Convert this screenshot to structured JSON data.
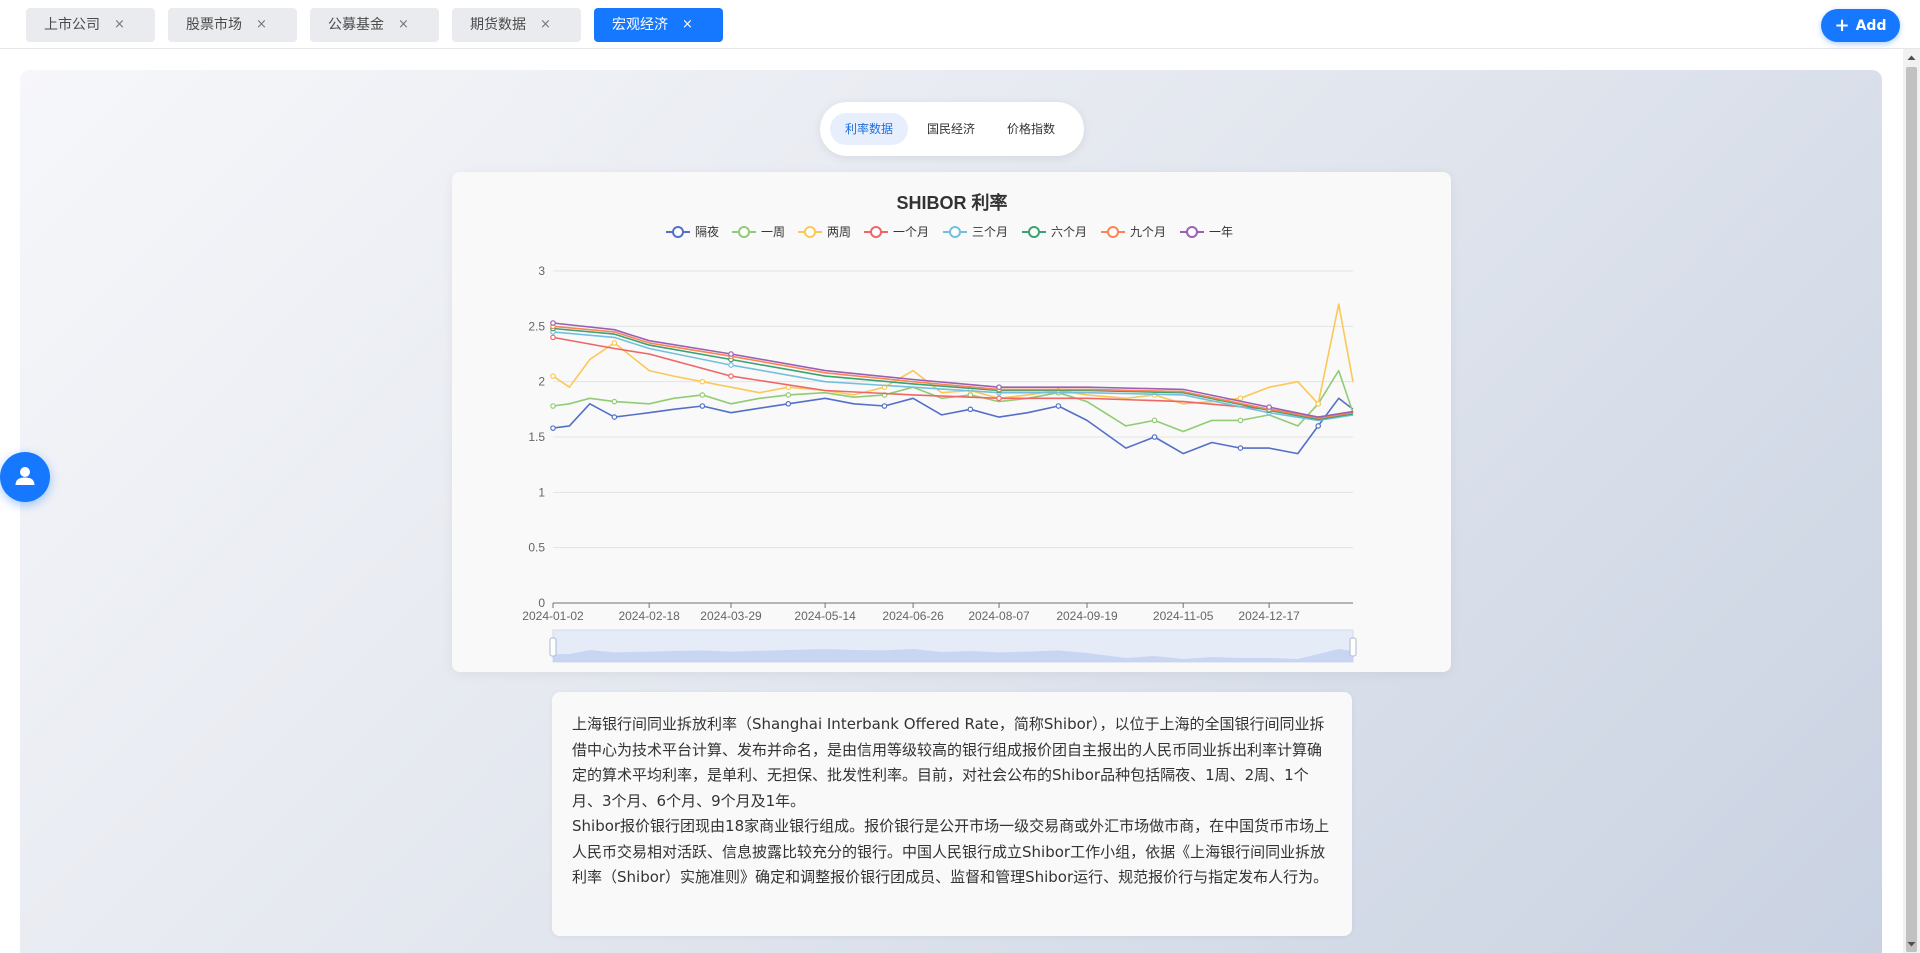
{
  "tabs": [
    {
      "label": "上市公司",
      "close": "×",
      "active": false
    },
    {
      "label": "股票市场",
      "close": "×",
      "active": false
    },
    {
      "label": "公募基金",
      "close": "×",
      "active": false
    },
    {
      "label": "期货数据",
      "close": "×",
      "active": false
    },
    {
      "label": "宏观经济",
      "close": "×",
      "active": true
    }
  ],
  "add_button": {
    "label": "Add",
    "icon": "plus-icon"
  },
  "subtabs": [
    {
      "label": "利率数据",
      "active": true
    },
    {
      "label": "国民经济",
      "active": false
    },
    {
      "label": "价格指数",
      "active": false
    }
  ],
  "colors": {
    "accent": "#1677ff"
  },
  "chart_data": {
    "type": "line",
    "title": "SHIBOR 利率",
    "ylim": [
      0,
      3
    ],
    "y_ticks": [
      "0",
      "0.5",
      "1",
      "1.5",
      "2",
      "2.5",
      "3"
    ],
    "x_tick_labels": [
      "2024-01-02",
      "2024-02-18",
      "2024-03-29",
      "2024-05-14",
      "2024-06-26",
      "2024-08-07",
      "2024-09-19",
      "2024-11-05",
      "2024-12-17"
    ],
    "x_range": [
      "2024-01-02",
      "2025-01-27"
    ],
    "legend_position": "top-center",
    "grid": true,
    "series": [
      {
        "name": "隔夜",
        "color": "#5470c6",
        "x": [
          "2024-01-02",
          "2024-01-10",
          "2024-01-20",
          "2024-02-01",
          "2024-02-18",
          "2024-03-01",
          "2024-03-15",
          "2024-03-29",
          "2024-04-12",
          "2024-04-26",
          "2024-05-14",
          "2024-05-28",
          "2024-06-12",
          "2024-06-26",
          "2024-07-10",
          "2024-07-24",
          "2024-08-07",
          "2024-08-21",
          "2024-09-05",
          "2024-09-19",
          "2024-10-08",
          "2024-10-22",
          "2024-11-05",
          "2024-11-19",
          "2024-12-03",
          "2024-12-17",
          "2024-12-31",
          "2025-01-10",
          "2025-01-20",
          "2025-01-27"
        ],
        "values": [
          1.58,
          1.6,
          1.8,
          1.68,
          1.72,
          1.75,
          1.78,
          1.72,
          1.76,
          1.8,
          1.85,
          1.8,
          1.78,
          1.85,
          1.7,
          1.75,
          1.68,
          1.72,
          1.78,
          1.65,
          1.4,
          1.5,
          1.35,
          1.45,
          1.4,
          1.4,
          1.35,
          1.6,
          1.85,
          1.75
        ]
      },
      {
        "name": "一周",
        "color": "#91cc75",
        "x": [
          "2024-01-02",
          "2024-01-10",
          "2024-01-20",
          "2024-02-01",
          "2024-02-18",
          "2024-03-01",
          "2024-03-15",
          "2024-03-29",
          "2024-04-12",
          "2024-04-26",
          "2024-05-14",
          "2024-05-28",
          "2024-06-12",
          "2024-06-26",
          "2024-07-10",
          "2024-07-24",
          "2024-08-07",
          "2024-08-21",
          "2024-09-05",
          "2024-09-19",
          "2024-10-08",
          "2024-10-22",
          "2024-11-05",
          "2024-11-19",
          "2024-12-03",
          "2024-12-17",
          "2024-12-31",
          "2025-01-10",
          "2025-01-20",
          "2025-01-27"
        ],
        "values": [
          1.78,
          1.8,
          1.85,
          1.82,
          1.8,
          1.85,
          1.88,
          1.8,
          1.85,
          1.88,
          1.9,
          1.86,
          1.88,
          1.95,
          1.85,
          1.88,
          1.82,
          1.85,
          1.9,
          1.82,
          1.6,
          1.65,
          1.55,
          1.65,
          1.65,
          1.7,
          1.6,
          1.8,
          2.1,
          1.72
        ]
      },
      {
        "name": "两周",
        "color": "#fac858",
        "x": [
          "2024-01-02",
          "2024-01-10",
          "2024-01-20",
          "2024-02-01",
          "2024-02-18",
          "2024-03-01",
          "2024-03-15",
          "2024-03-29",
          "2024-04-12",
          "2024-04-26",
          "2024-05-14",
          "2024-05-28",
          "2024-06-12",
          "2024-06-26",
          "2024-07-10",
          "2024-07-24",
          "2024-08-07",
          "2024-08-21",
          "2024-09-05",
          "2024-09-19",
          "2024-10-08",
          "2024-10-22",
          "2024-11-05",
          "2024-11-19",
          "2024-12-03",
          "2024-12-17",
          "2024-12-31",
          "2025-01-10",
          "2025-01-20",
          "2025-01-27"
        ],
        "values": [
          2.05,
          1.95,
          2.2,
          2.35,
          2.1,
          2.05,
          2.0,
          1.95,
          1.9,
          1.95,
          1.92,
          1.88,
          1.95,
          2.1,
          1.9,
          1.92,
          1.85,
          1.88,
          1.92,
          1.88,
          1.85,
          1.88,
          1.8,
          1.82,
          1.85,
          1.95,
          2.0,
          1.8,
          2.7,
          2.0
        ]
      },
      {
        "name": "一个月",
        "color": "#ee6666",
        "x": [
          "2024-01-02",
          "2024-02-01",
          "2024-02-18",
          "2024-03-29",
          "2024-05-14",
          "2024-06-26",
          "2024-08-07",
          "2024-09-19",
          "2024-11-05",
          "2024-12-17",
          "2025-01-10",
          "2025-01-27"
        ],
        "values": [
          2.4,
          2.3,
          2.25,
          2.05,
          1.92,
          1.88,
          1.85,
          1.85,
          1.82,
          1.75,
          1.68,
          1.7
        ]
      },
      {
        "name": "三个月",
        "color": "#73c0de",
        "x": [
          "2024-01-02",
          "2024-02-01",
          "2024-02-18",
          "2024-03-29",
          "2024-05-14",
          "2024-06-26",
          "2024-08-07",
          "2024-09-19",
          "2024-11-05",
          "2024-12-17",
          "2025-01-10",
          "2025-01-27"
        ],
        "values": [
          2.45,
          2.4,
          2.3,
          2.15,
          2.0,
          1.95,
          1.9,
          1.9,
          1.88,
          1.72,
          1.65,
          1.7
        ]
      },
      {
        "name": "六个月",
        "color": "#3ba272",
        "x": [
          "2024-01-02",
          "2024-02-01",
          "2024-02-18",
          "2024-03-29",
          "2024-05-14",
          "2024-06-26",
          "2024-08-07",
          "2024-09-19",
          "2024-11-05",
          "2024-12-17",
          "2025-01-10",
          "2025-01-27"
        ],
        "values": [
          2.48,
          2.43,
          2.33,
          2.2,
          2.05,
          1.98,
          1.92,
          1.92,
          1.9,
          1.74,
          1.66,
          1.71
        ]
      },
      {
        "name": "九个月",
        "color": "#fc8452",
        "x": [
          "2024-01-02",
          "2024-02-01",
          "2024-02-18",
          "2024-03-29",
          "2024-05-14",
          "2024-06-26",
          "2024-08-07",
          "2024-09-19",
          "2024-11-05",
          "2024-12-17",
          "2025-01-10",
          "2025-01-27"
        ],
        "values": [
          2.5,
          2.45,
          2.35,
          2.23,
          2.08,
          2.0,
          1.93,
          1.93,
          1.91,
          1.75,
          1.67,
          1.72
        ]
      },
      {
        "name": "一年",
        "color": "#9a60b4",
        "x": [
          "2024-01-02",
          "2024-02-01",
          "2024-02-18",
          "2024-03-29",
          "2024-05-14",
          "2024-06-26",
          "2024-08-07",
          "2024-09-19",
          "2024-11-05",
          "2024-12-17",
          "2025-01-10",
          "2025-01-27"
        ],
        "values": [
          2.53,
          2.47,
          2.37,
          2.25,
          2.1,
          2.02,
          1.95,
          1.95,
          1.93,
          1.77,
          1.68,
          1.73
        ]
      }
    ]
  },
  "description": {
    "paragraph1": "上海银行间同业拆放利率（Shanghai Interbank Offered Rate，简称Shibor），以位于上海的全国银行间同业拆借中心为技术平台计算、发布并命名，是由信用等级较高的银行组成报价团自主报出的人民币同业拆出利率计算确定的算术平均利率，是单利、无担保、批发性利率。目前，对社会公布的Shibor品种包括隔夜、1周、2周、1个月、3个月、6个月、9个月及1年。",
    "paragraph2": "Shibor报价银行团现由18家商业银行组成。报价银行是公开市场一级交易商或外汇市场做市商，在中国货币市场上人民币交易相对活跃、信息披露比较充分的银行。中国人民银行成立Shibor工作小组，依据《上海银行间同业拆放利率（Shibor）实施准则》确定和调整报价银行团成员、监督和管理Shibor运行、规范报价行与指定发布人行为。"
  }
}
